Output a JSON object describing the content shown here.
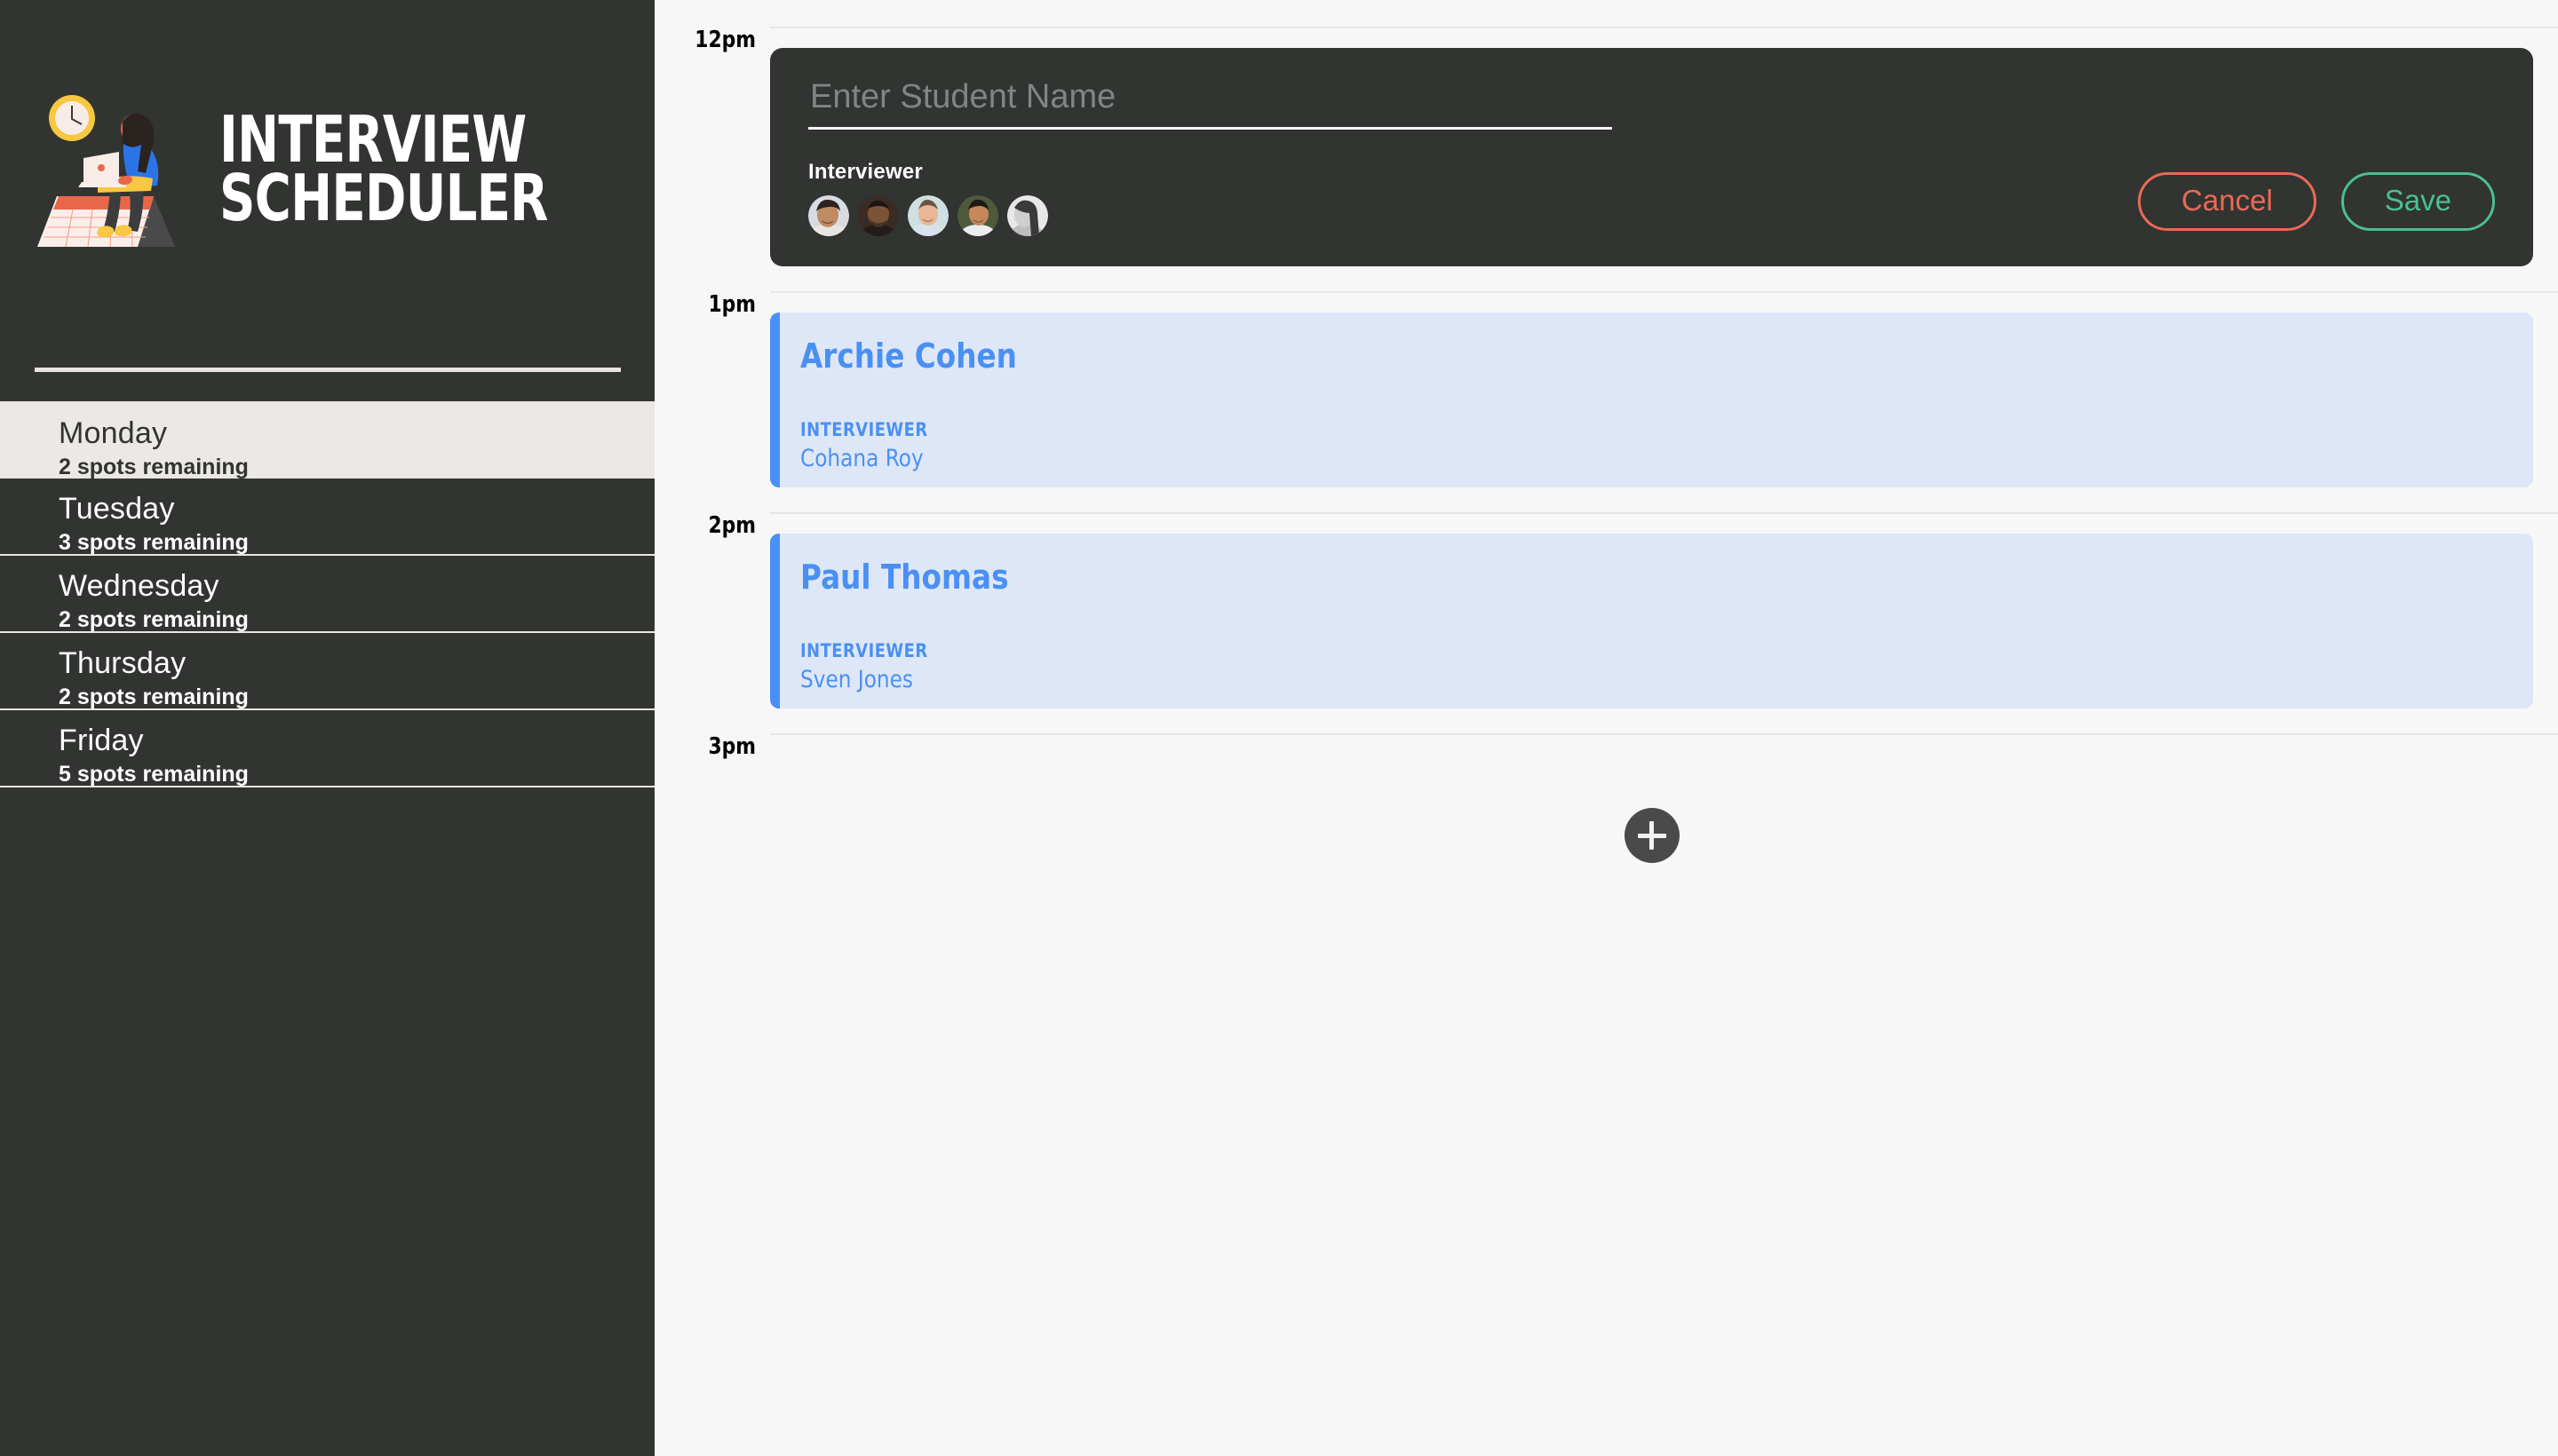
{
  "app": {
    "title_line1": "INTERVIEW",
    "title_line2": "SCHEDULER",
    "logo_icon": "person-at-desk-with-clock-and-calendar-illustration"
  },
  "colors": {
    "sidebar_bg": "#313431",
    "sidebar_selected_bg": "#ebe8e7",
    "main_bg": "#f7f7f7",
    "appointment_card_bg": "#dee7f7",
    "appointment_accent": "#4a90f4",
    "cancel_accent": "#ea6a56",
    "save_accent": "#4bbf95",
    "add_button_bg": "#4a4a4a"
  },
  "sidebar": {
    "days": [
      {
        "name": "Monday",
        "spots": "2 spots remaining",
        "selected": true
      },
      {
        "name": "Tuesday",
        "spots": "3 spots remaining",
        "selected": false
      },
      {
        "name": "Wednesday",
        "spots": "2 spots remaining",
        "selected": false
      },
      {
        "name": "Thursday",
        "spots": "2 spots remaining",
        "selected": false
      },
      {
        "name": "Friday",
        "spots": "5 spots remaining",
        "selected": false
      }
    ]
  },
  "schedule": {
    "slots": [
      {
        "time": "12pm",
        "kind": "form"
      },
      {
        "time": "1pm",
        "kind": "appointment",
        "index": 0
      },
      {
        "time": "2pm",
        "kind": "appointment",
        "index": 1
      },
      {
        "time": "3pm",
        "kind": "empty"
      }
    ],
    "appointments": [
      {
        "student": "Archie Cohen",
        "interviewer_label": "INTERVIEWER",
        "interviewer": "Cohana Roy"
      },
      {
        "student": "Paul Thomas",
        "interviewer_label": "INTERVIEWER",
        "interviewer": "Sven Jones"
      }
    ]
  },
  "form": {
    "student_value": "",
    "student_placeholder": "Enter Student Name",
    "interviewer_label": "Interviewer",
    "cancel_label": "Cancel",
    "save_label": "Save",
    "interviewers": [
      {
        "name": "interviewer-avatar-1",
        "skin": "#c08a63",
        "hair": "#2b2320",
        "bg": "#d7dce2",
        "shirt": "#e9e6e2"
      },
      {
        "name": "interviewer-avatar-2",
        "skin": "#7a5338",
        "hair": "#1a1412",
        "bg": "#3a2c24",
        "shirt": "#241c18"
      },
      {
        "name": "interviewer-avatar-3",
        "skin": "#e8b796",
        "hair": "#6d5340",
        "bg": "#cfe0e2",
        "shirt": "#d9e2ec"
      },
      {
        "name": "interviewer-avatar-4",
        "skin": "#c5875c",
        "hair": "#1d1a14",
        "bg": "#4e5a3a",
        "shirt": "#ededed"
      },
      {
        "name": "interviewer-avatar-5",
        "skin": "#cfcfcf",
        "hair": "#3a3a3a",
        "bg": "#e8e8e8",
        "shirt": "#bdbdbd"
      }
    ]
  },
  "add_button": {
    "icon": "plus-icon",
    "label": "+"
  }
}
